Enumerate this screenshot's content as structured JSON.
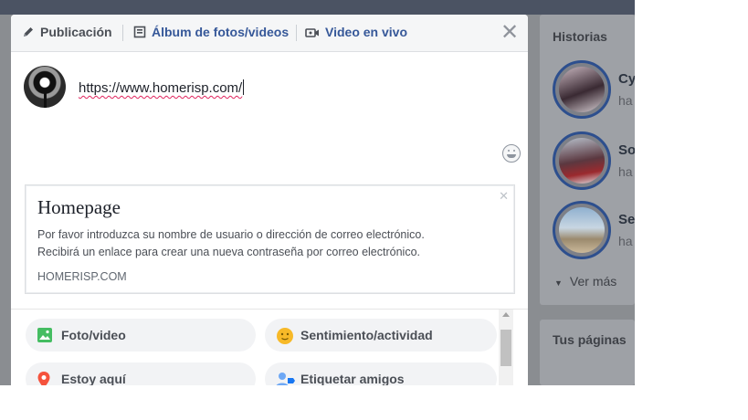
{
  "background": {
    "stories": {
      "title": "Historias",
      "items": [
        {
          "name": "Cy",
          "sub": "ha"
        },
        {
          "name": "So",
          "sub": "ha"
        },
        {
          "name": "Se",
          "sub": "ha"
        }
      ],
      "more": "Ver más"
    },
    "pages": {
      "title": "Tus páginas"
    }
  },
  "composer": {
    "tabs": [
      {
        "label": "Publicación",
        "icon": "pencil-icon"
      },
      {
        "label": "Álbum de fotos/videos",
        "icon": "album-icon"
      },
      {
        "label": "Video en vivo",
        "icon": "video-camera-icon"
      }
    ],
    "close_icon": "close-icon",
    "post_text": "https://www.homerisp.com/",
    "link_preview": {
      "title": "Homepage",
      "description_line1": "Por favor introduzca su nombre de usuario o dirección de correo electrónico.",
      "description_line2": "Recibirá un enlace para crear una nueva contraseña por correo electrónico.",
      "domain": "HOMERISP.COM"
    },
    "options": [
      {
        "label": "Foto/video",
        "icon": "photo-icon",
        "color": "#45bd62"
      },
      {
        "label": "Sentimiento/actividad",
        "icon": "smiley-icon",
        "color": "#f7b928"
      },
      {
        "label": "Estoy aquí",
        "icon": "location-pin-icon",
        "color": "#f5533d"
      },
      {
        "label": "Etiquetar amigos",
        "icon": "tag-friends-icon",
        "color": "#1877f2"
      }
    ]
  },
  "colors": {
    "link": "#365899",
    "overlay": "#8a8d91",
    "story_ring": "#2d4f8e"
  }
}
